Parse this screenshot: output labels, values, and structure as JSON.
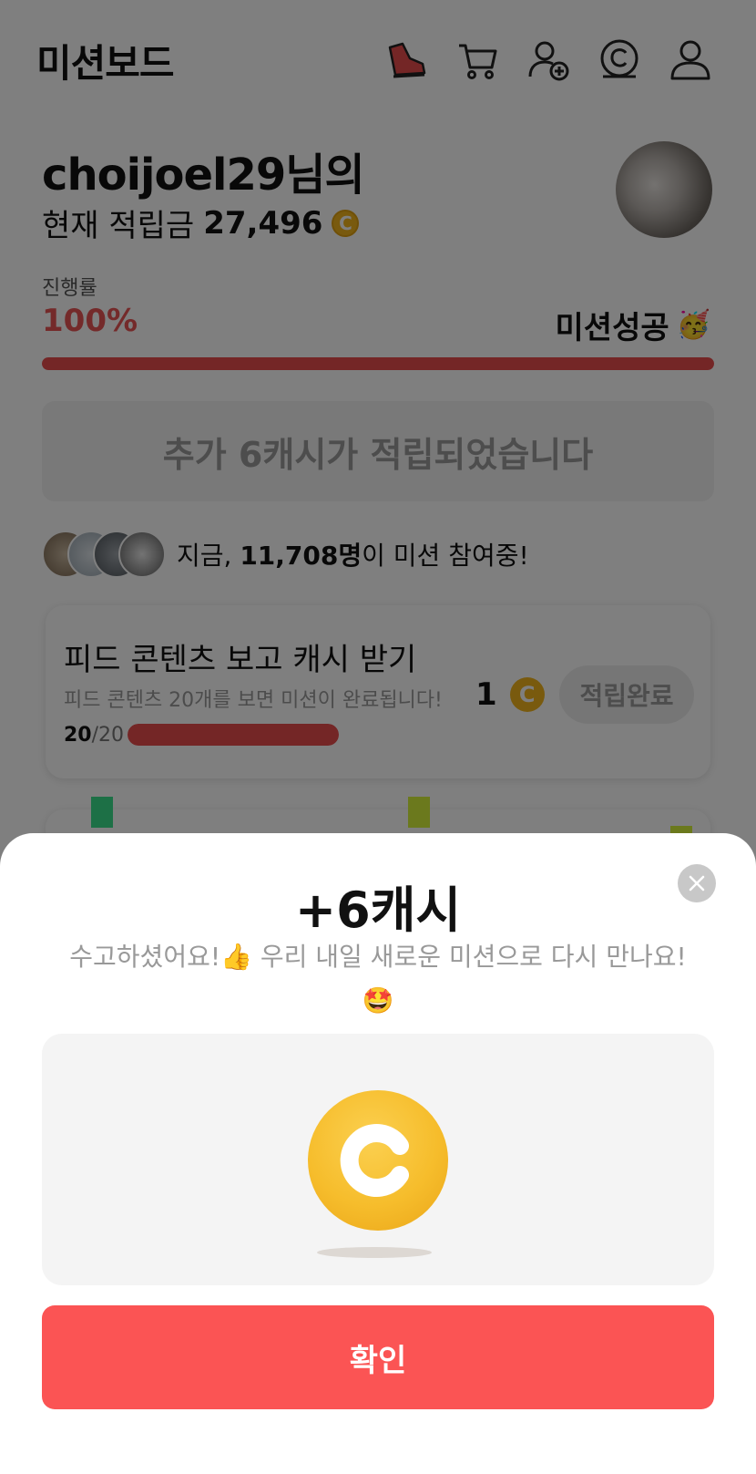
{
  "header": {
    "title": "미션보드",
    "icons": [
      "sneaker-icon",
      "cart-icon",
      "add-user-icon",
      "cash-coin-icon",
      "profile-icon"
    ]
  },
  "greeting": {
    "name_line": "choijoel29님의",
    "balance_label": "현재 적립금",
    "balance_value": "27,496",
    "coin_symbol": "C"
  },
  "progress": {
    "label": "진행률",
    "percent_text": "100%",
    "value": 1.0,
    "status": "미션성공",
    "status_emoji": "🥳"
  },
  "notice": {
    "text": "추가 6캐시가 적립되었습니다"
  },
  "participants": {
    "prefix": "지금, ",
    "count": "11,708명",
    "suffix": "이 미션 참여중!"
  },
  "mission": {
    "title": "피드 콘텐츠 보고 캐시 받기",
    "description": "피드 콘텐츠 20개를 보면 미션이 완료됩니다!",
    "reward": "1",
    "button": "적립완료",
    "done": "20",
    "total": "/20",
    "fraction": 1.0
  },
  "sheet": {
    "title": "+6캐시",
    "message": "수고하셨어요!👍 우리 내일 새로운 미션으로 다시 만나요!",
    "emoji": "🤩",
    "confirm_label": "확인"
  },
  "colors": {
    "accent": "#e84c4d",
    "confirm": "#fb5454",
    "coin": "#f2b51d"
  }
}
